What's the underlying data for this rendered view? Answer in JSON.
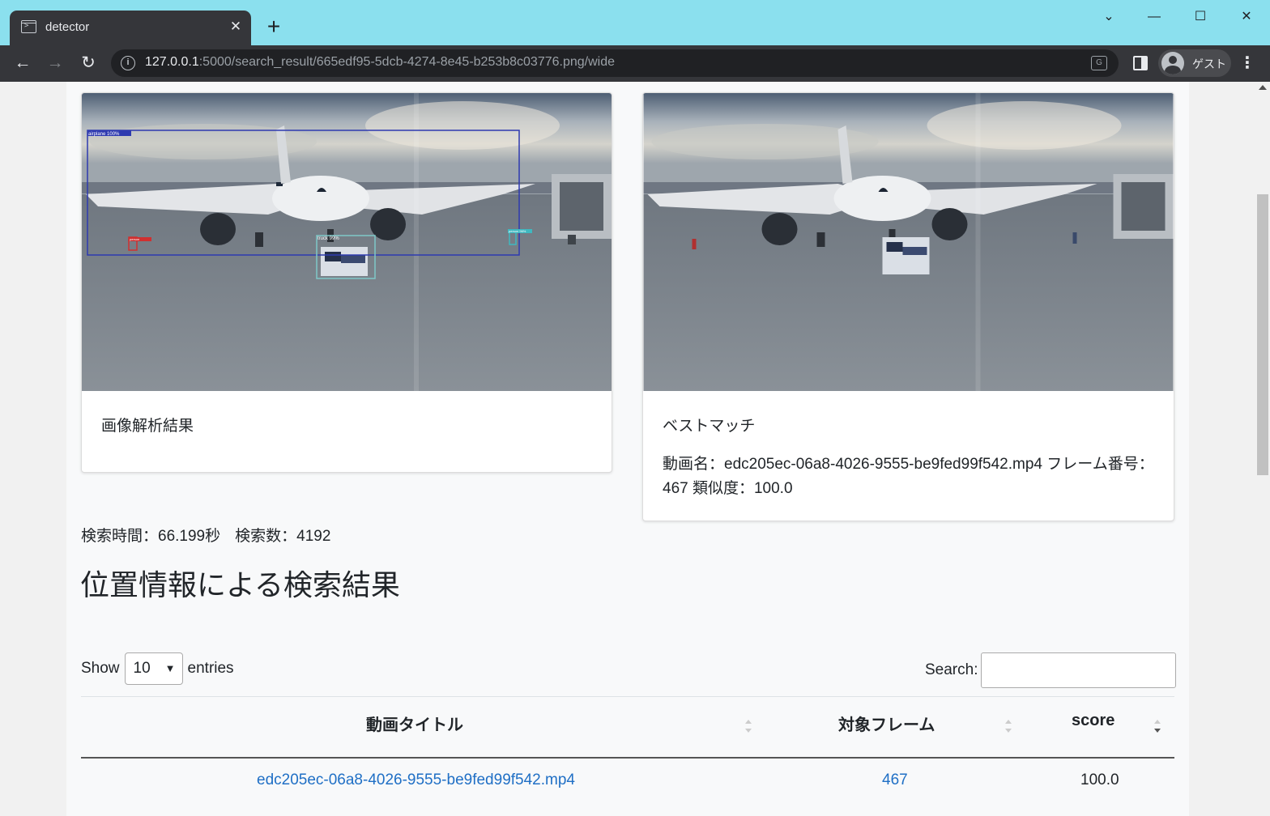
{
  "browser": {
    "tab_title": "detector",
    "url_host": "127.0.0.1",
    "url_rest": ":5000/search_result/665edf95-5dcb-4274-8e45-b253b8c03776.png/wide",
    "profile_label": "ゲスト"
  },
  "cards": {
    "analysis": {
      "title": "画像解析結果",
      "detections": [
        {
          "label": "airplane 100%"
        },
        {
          "label": "truck 99%"
        },
        {
          "label": "person"
        },
        {
          "label": "person 96%"
        }
      ]
    },
    "best_match": {
      "title": "ベストマッチ",
      "detail": "動画名：edc205ec-06a8-4026-9555-be9fed99f542.mp4 フレーム番号：467 類似度：100.0"
    }
  },
  "stats": {
    "search_time": "検索時間：66.199秒",
    "search_count": "検索数：4192"
  },
  "section_heading": "位置情報による検索結果",
  "datatable": {
    "show_label": "Show",
    "entries_label": "entries",
    "page_length": "10",
    "search_label": "Search:",
    "search_value": "",
    "columns": [
      "動画タイトル",
      "対象フレーム",
      "score"
    ],
    "rows": [
      [
        "edc205ec-06a8-4026-9555-be9fed99f542.mp4",
        "467",
        "100.0"
      ]
    ]
  },
  "colors": {
    "tabbar": "#8be0ee",
    "toolbar": "#35363a",
    "link": "#1f6fc5"
  }
}
